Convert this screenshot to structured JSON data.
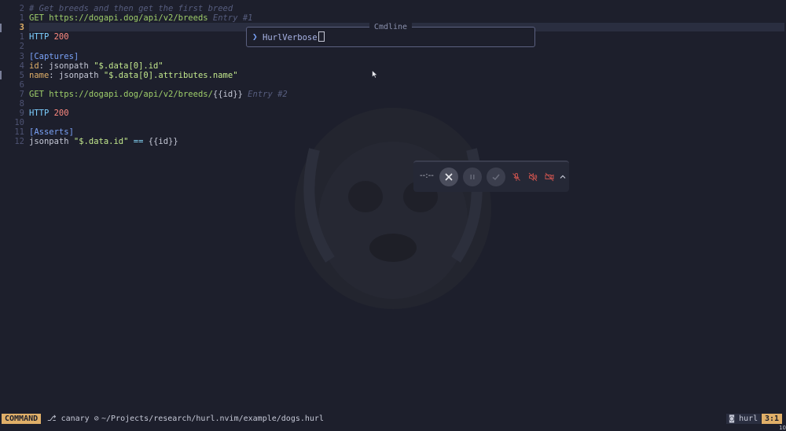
{
  "editor": {
    "lines": [
      {
        "num": "2",
        "tokens": [
          {
            "c": "comment",
            "t": "# Get breeds and then get the first breed"
          }
        ]
      },
      {
        "num": "1",
        "tokens": [
          {
            "c": "method",
            "t": "GET "
          },
          {
            "c": "url",
            "t": "https://dogapi.dog/api/v2/breeds"
          },
          {
            "c": "ghost",
            "t": " Entry #1"
          }
        ]
      },
      {
        "num": "3",
        "current": true,
        "tokens": []
      },
      {
        "num": "1",
        "tokens": [
          {
            "c": "http",
            "t": "HTTP "
          },
          {
            "c": "status",
            "t": "200"
          }
        ]
      },
      {
        "num": "2",
        "tokens": []
      },
      {
        "num": "3",
        "tokens": [
          {
            "c": "section",
            "t": "[Captures]"
          }
        ]
      },
      {
        "num": "4",
        "tokens": [
          {
            "c": "key",
            "t": "id"
          },
          {
            "c": "plain",
            "t": ": jsonpath "
          },
          {
            "c": "str",
            "t": "\"$.data[0].id\""
          }
        ]
      },
      {
        "num": "5",
        "tokens": [
          {
            "c": "key",
            "t": "name"
          },
          {
            "c": "plain",
            "t": ": jsonpath "
          },
          {
            "c": "str",
            "t": "\"$.data[0].attributes.name\""
          }
        ]
      },
      {
        "num": "6",
        "tokens": []
      },
      {
        "num": "7",
        "tokens": [
          {
            "c": "method",
            "t": "GET "
          },
          {
            "c": "url",
            "t": "https://dogapi.dog/api/v2/breeds/"
          },
          {
            "c": "var",
            "t": "{{id}}"
          },
          {
            "c": "ghost",
            "t": " Entry #2"
          }
        ]
      },
      {
        "num": "8",
        "tokens": []
      },
      {
        "num": "9",
        "tokens": [
          {
            "c": "http",
            "t": "HTTP "
          },
          {
            "c": "status",
            "t": "200"
          }
        ]
      },
      {
        "num": "10",
        "tokens": []
      },
      {
        "num": "11",
        "tokens": [
          {
            "c": "section",
            "t": "[Asserts]"
          }
        ]
      },
      {
        "num": "12",
        "tokens": [
          {
            "c": "plain",
            "t": "jsonpath "
          },
          {
            "c": "str",
            "t": "\"$.data.id\""
          },
          {
            "c": "op",
            "t": " == "
          },
          {
            "c": "var",
            "t": "{{id}}"
          }
        ]
      }
    ]
  },
  "cmdline": {
    "title": "Cmdline",
    "prompt_icon": "chevron-right-icon",
    "text": "HurlVerbose"
  },
  "toolbar": {
    "time": "--:--",
    "icons": [
      "close-icon",
      "pause-icon",
      "check-icon",
      "mic-muted-icon",
      "speaker-muted-icon",
      "camera-off-icon",
      "chevron-up-icon"
    ]
  },
  "status": {
    "mode": "COMMAND",
    "branch_icon": "git-branch-icon",
    "branch": "canary",
    "path": "~/Projects/research/hurl.nvim/example/dogs.hurl",
    "filetype_icon": "hurl-icon",
    "filetype": "hurl",
    "position": "3:1"
  },
  "corner_text": "10"
}
